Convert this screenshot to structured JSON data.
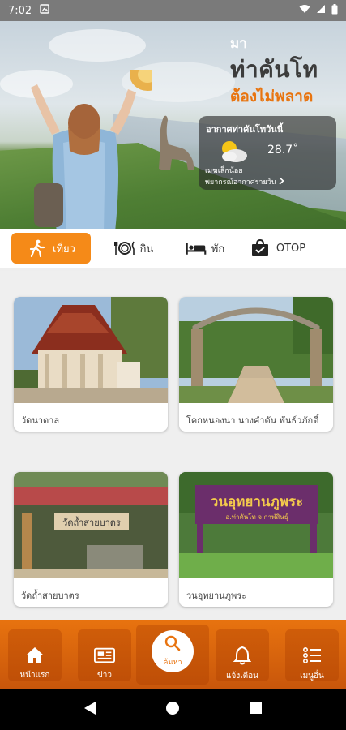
{
  "status_bar": {
    "time": "7:02",
    "icons": [
      "notification-icon",
      "wifi-icon",
      "signal-icon",
      "battery-icon"
    ]
  },
  "hero": {
    "title_small": "มา",
    "title": "ท่าคันโท",
    "subtitle": "ต้องไม่พลาด",
    "subtitle_color": "#e8740f",
    "weather": {
      "title": "อากาศท่าคันโทวันนี้",
      "icon": "partly-cloudy-icon",
      "temperature": "28.7˚",
      "description": "เมฆเล็กน้อย",
      "link": "พยากรณ์อากาศรายวัน"
    }
  },
  "categories": [
    {
      "label": "เที่ยว",
      "icon": "hiking-icon",
      "active": true
    },
    {
      "label": "กิน",
      "icon": "dining-icon",
      "active": false
    },
    {
      "label": "พัก",
      "icon": "bed-icon",
      "active": false
    },
    {
      "label": "OTOP",
      "icon": "shopping-bag-icon",
      "active": false
    }
  ],
  "places": [
    {
      "name": "วัดนาตาล"
    },
    {
      "name": "โคกหนองนา นางคำดัน พันธ์วภักดิ์"
    },
    {
      "name": "วัดถ้ำสายบาตร"
    },
    {
      "name": "วนอุทยานภูพระ"
    }
  ],
  "place_image_texts": {
    "sign_wat": "วัดถ้ำสายบาตร",
    "sign_park_main": "วนอุทยานภูพระ",
    "sign_park_sub": "อ.ท่าคันโท   จ.กาฬสินธุ์"
  },
  "bottom_nav": {
    "accent_color": "#e8730f",
    "items": [
      {
        "label": "หน้าแรก",
        "icon": "home-icon"
      },
      {
        "label": "ข่าว",
        "icon": "news-icon"
      },
      {
        "label": "ค้นหา",
        "icon": "search-icon"
      },
      {
        "label": "แจ้งเตือน",
        "icon": "bell-icon"
      },
      {
        "label": "เมนูอื่น",
        "icon": "menu-list-icon"
      }
    ]
  },
  "android_nav": [
    "back-icon",
    "home-circle-icon",
    "recents-icon"
  ]
}
